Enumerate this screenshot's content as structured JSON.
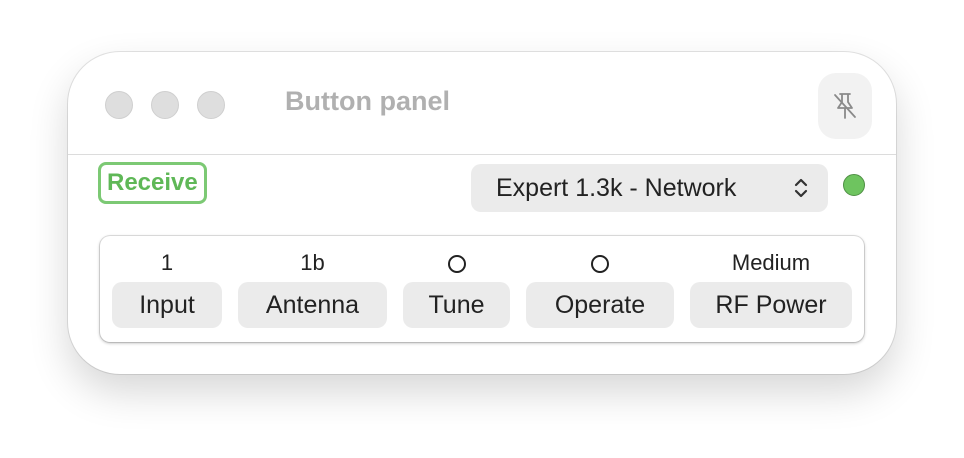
{
  "window": {
    "title": "Button panel"
  },
  "toolbar": {
    "receive_label": "Receive",
    "device_select": "Expert 1.3k - Network",
    "status_color": "#6ec45f"
  },
  "panel": {
    "controls": [
      {
        "value": "1",
        "label": "Input"
      },
      {
        "value": "1b",
        "label": "Antenna"
      },
      {
        "value": "",
        "indicator": "circle",
        "label": "Tune"
      },
      {
        "value": "",
        "indicator": "circle",
        "label": "Operate"
      },
      {
        "value": "Medium",
        "label": "RF Power"
      }
    ]
  },
  "icons": {
    "pin": "pin-slash-icon",
    "select_chevrons": "up-down-chevron-icon"
  }
}
